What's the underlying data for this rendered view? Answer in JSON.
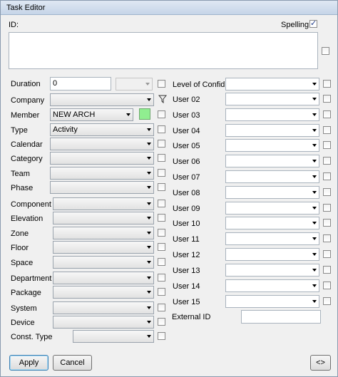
{
  "window": {
    "title": "Task Editor"
  },
  "header": {
    "id_label": "ID:",
    "spelling_label": "Spelling",
    "spelling_checked": true,
    "id_value": ""
  },
  "left": {
    "duration": {
      "label": "Duration",
      "value": "0"
    },
    "rows": [
      {
        "label": "Company",
        "value": ""
      },
      {
        "label": "Member",
        "value": "NEW ARCH"
      },
      {
        "label": "Type",
        "value": "Activity"
      },
      {
        "label": "Calendar",
        "value": ""
      },
      {
        "label": "Category",
        "value": ""
      },
      {
        "label": "Team",
        "value": ""
      },
      {
        "label": "Phase",
        "value": ""
      },
      {
        "label": "Component",
        "value": ""
      },
      {
        "label": "Elevation",
        "value": ""
      },
      {
        "label": "Zone",
        "value": ""
      },
      {
        "label": "Floor",
        "value": ""
      },
      {
        "label": "Space",
        "value": ""
      },
      {
        "label": "Department",
        "value": ""
      },
      {
        "label": "Package",
        "value": ""
      },
      {
        "label": "System",
        "value": ""
      },
      {
        "label": "Device",
        "value": ""
      },
      {
        "label": "Const. Type",
        "value": ""
      }
    ],
    "member_color": "#90ee90"
  },
  "right": {
    "rows": [
      {
        "label": "Level of Confid",
        "value": ""
      },
      {
        "label": "User 02",
        "value": ""
      },
      {
        "label": "User 03",
        "value": ""
      },
      {
        "label": "User 04",
        "value": ""
      },
      {
        "label": "User 05",
        "value": ""
      },
      {
        "label": "User 06",
        "value": ""
      },
      {
        "label": "User 07",
        "value": ""
      },
      {
        "label": "User 08",
        "value": ""
      },
      {
        "label": "User 09",
        "value": ""
      },
      {
        "label": "User 10",
        "value": ""
      },
      {
        "label": "User 11",
        "value": ""
      },
      {
        "label": "User 12",
        "value": ""
      },
      {
        "label": "User 13",
        "value": ""
      },
      {
        "label": "User 14",
        "value": ""
      },
      {
        "label": "User 15",
        "value": ""
      }
    ],
    "external_id": {
      "label": "External ID",
      "value": ""
    }
  },
  "footer": {
    "apply_label": "Apply",
    "cancel_label": "Cancel",
    "toggle_label": "<>"
  }
}
